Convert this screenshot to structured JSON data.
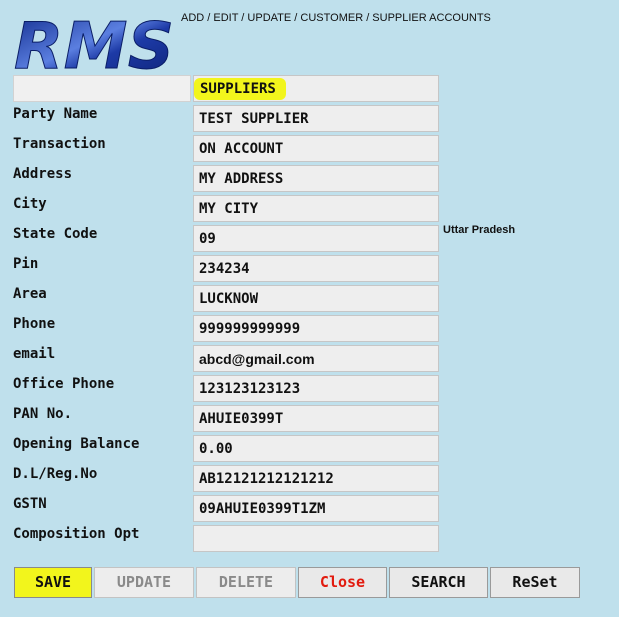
{
  "header": {
    "logo_text": "RMS",
    "breadcrumb": "ADD / EDIT / UPDATE / CUSTOMER / SUPPLIER ACCOUNTS"
  },
  "form": {
    "account_type": "SUPPLIERS",
    "state_name": "Uttar Pradesh",
    "fields": [
      {
        "label": "Party Name",
        "value": "TEST SUPPLIER"
      },
      {
        "label": "Transaction",
        "value": "ON ACCOUNT"
      },
      {
        "label": "Address",
        "value": "MY ADDRESS"
      },
      {
        "label": "City",
        "value": "MY CITY"
      },
      {
        "label": "State Code",
        "value": "09"
      },
      {
        "label": "Pin",
        "value": "234234"
      },
      {
        "label": "Area",
        "value": "LUCKNOW"
      },
      {
        "label": "Phone",
        "value": "999999999999"
      },
      {
        "label": "email",
        "value": "abcd@gmail.com"
      },
      {
        "label": "Office Phone",
        "value": "123123123123"
      },
      {
        "label": "PAN No.",
        "value": "AHUIE0399T"
      },
      {
        "label": "Opening Balance",
        "value": "0.00"
      },
      {
        "label": "D.L/Reg.No",
        "value": "AB12121212121212"
      },
      {
        "label": "GSTN",
        "value": "09AHUIE0399T1ZM"
      },
      {
        "label": "Composition Opt",
        "value": ""
      }
    ]
  },
  "buttons": {
    "save": "SAVE",
    "update": "UPDATE",
    "delete": "DELETE",
    "close": "Close",
    "search": "SEARCH",
    "reset": "ReSet"
  },
  "colors": {
    "background": "#bfe0ec",
    "highlight": "#f2f51c",
    "close_text": "#e21b0f",
    "logo_blue": "#1e3aa8"
  }
}
